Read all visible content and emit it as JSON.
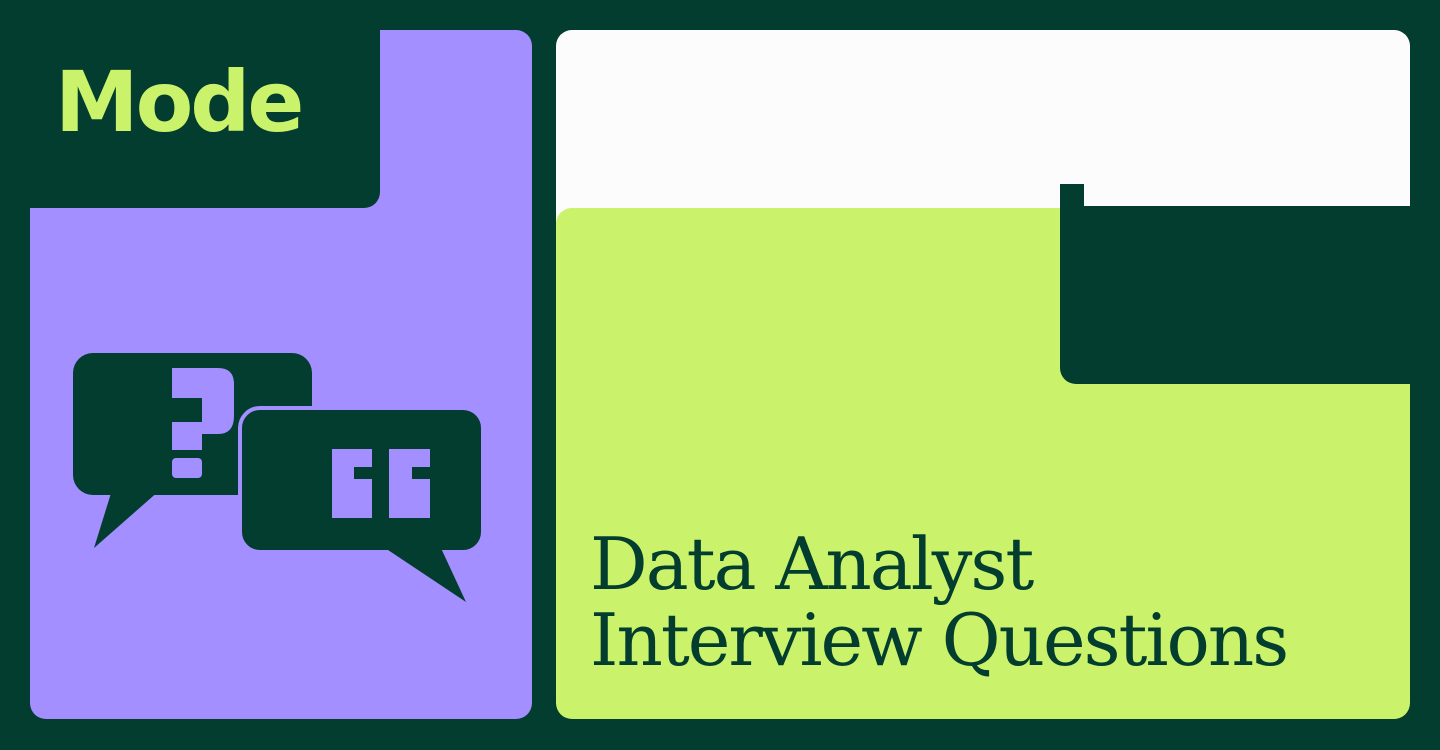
{
  "brand": {
    "logo_text": "Mode"
  },
  "headline": {
    "line1": "Data Analyst",
    "line2": "Interview Questions"
  },
  "colors": {
    "background": "#033d2f",
    "purple": "#a38fff",
    "lime": "#caf26a",
    "white": "#fcfcfc",
    "logo": "#caf26a",
    "text": "#033d2f"
  },
  "icons": {
    "question_bubble": "question-bubble-icon",
    "quote_bubble": "quote-bubble-icon"
  }
}
